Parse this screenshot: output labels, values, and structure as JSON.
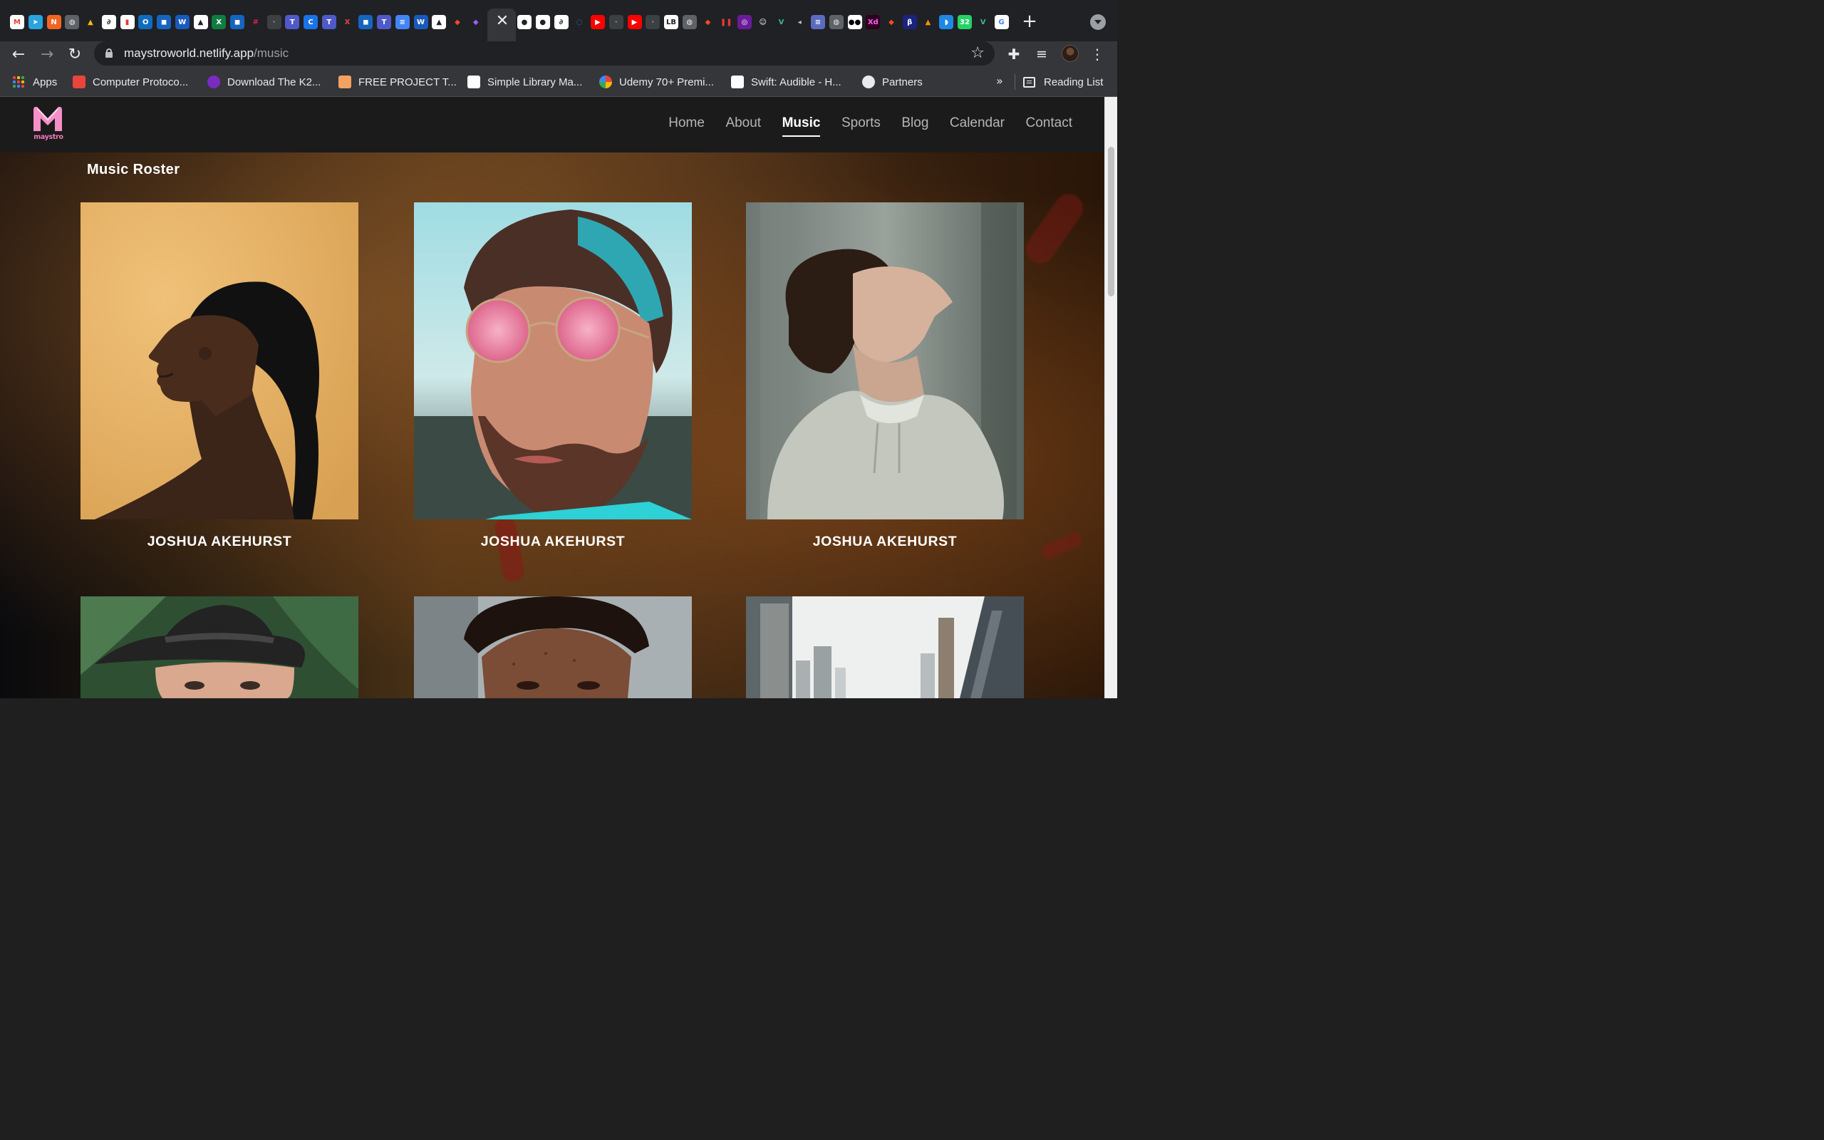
{
  "browser": {
    "tab_icons": [
      {
        "name": "gmail-icon",
        "color": "#ffffff",
        "fg": "#ea4335",
        "glyph": "M"
      },
      {
        "name": "telegram-icon",
        "color": "#2aa3df",
        "fg": "#ffffff",
        "glyph": "➤"
      },
      {
        "name": "tab-orange-icon",
        "color": "#f26522",
        "fg": "#ffffff",
        "glyph": "N"
      },
      {
        "name": "globe-icon",
        "color": "#5f6368",
        "fg": "#e8eaed",
        "glyph": "◍"
      },
      {
        "name": "google-drive-icon",
        "color": "#202124",
        "fg": "#fbbc04",
        "glyph": "▲"
      },
      {
        "name": "tab-yellow-icon",
        "color": "#ffffff",
        "fg": "#202124",
        "glyph": "∂"
      },
      {
        "name": "tab-red-white-icon",
        "color": "#ffffff",
        "fg": "#e53935",
        "glyph": "▮"
      },
      {
        "name": "outlook-icon",
        "color": "#0f6cbd",
        "fg": "#ffffff",
        "glyph": "O"
      },
      {
        "name": "tab-blue-shield-icon",
        "color": "#1565c0",
        "fg": "#ffffff",
        "glyph": "◼"
      },
      {
        "name": "word-icon",
        "color": "#185abd",
        "fg": "#ffffff",
        "glyph": "W"
      },
      {
        "name": "tab-triangle-icon",
        "color": "#ffffff",
        "fg": "#202124",
        "glyph": "▲"
      },
      {
        "name": "excel-icon",
        "color": "#107c41",
        "fg": "#ffffff",
        "glyph": "X"
      },
      {
        "name": "tab-blue-shield-icon",
        "color": "#1565c0",
        "fg": "#ffffff",
        "glyph": "◼"
      },
      {
        "name": "slack-icon",
        "color": "#202124",
        "fg": "#e01e5a",
        "glyph": "#"
      },
      {
        "name": "tab-dark-icon",
        "color": "#3c4043",
        "fg": "#9aa0a6",
        "glyph": "·"
      },
      {
        "name": "teams-icon",
        "color": "#5059c9",
        "fg": "#ffffff",
        "glyph": "T"
      },
      {
        "name": "tab-c-icon",
        "color": "#1a73e8",
        "fg": "#ffffff",
        "glyph": "C"
      },
      {
        "name": "teams-icon",
        "color": "#5059c9",
        "fg": "#ffffff",
        "glyph": "T"
      },
      {
        "name": "tab-x-icon",
        "color": "#202124",
        "fg": "#e8453c",
        "glyph": "X"
      },
      {
        "name": "tab-blue-shield-icon",
        "color": "#1565c0",
        "fg": "#ffffff",
        "glyph": "◼"
      },
      {
        "name": "teams-icon",
        "color": "#5059c9",
        "fg": "#ffffff",
        "glyph": "T"
      },
      {
        "name": "google-docs-icon",
        "color": "#4285f4",
        "fg": "#ffffff",
        "glyph": "≡"
      },
      {
        "name": "word-icon",
        "color": "#185abd",
        "fg": "#ffffff",
        "glyph": "W"
      },
      {
        "name": "tab-triangle-icon",
        "color": "#ffffff",
        "fg": "#202124",
        "glyph": "▲"
      },
      {
        "name": "figma-icon",
        "color": "#202124",
        "fg": "#f24e1e",
        "glyph": "◆"
      },
      {
        "name": "figma-icon",
        "color": "#202124",
        "fg": "#a259ff",
        "glyph": "◆"
      }
    ],
    "tab_icons_right": [
      {
        "name": "github-icon",
        "color": "#ffffff",
        "fg": "#202124",
        "glyph": "●"
      },
      {
        "name": "github-icon",
        "color": "#ffffff",
        "fg": "#202124",
        "glyph": "●"
      },
      {
        "name": "tab-yellow-icon",
        "color": "#ffffff",
        "fg": "#202124",
        "glyph": "∂"
      },
      {
        "name": "tab-blue-circle-icon",
        "color": "#202124",
        "fg": "#4285f4",
        "glyph": "◌"
      },
      {
        "name": "youtube-icon",
        "color": "#ff0000",
        "fg": "#ffffff",
        "glyph": "▶"
      },
      {
        "name": "tab-dark-icon",
        "color": "#3c4043",
        "fg": "#9aa0a6",
        "glyph": "·"
      },
      {
        "name": "youtube-icon",
        "color": "#ff0000",
        "fg": "#ffffff",
        "glyph": "▶"
      },
      {
        "name": "tab-dark-icon",
        "color": "#3c4043",
        "fg": "#9aa0a6",
        "glyph": "·"
      },
      {
        "name": "lb-icon",
        "color": "#ffffff",
        "fg": "#202124",
        "glyph": "LB"
      },
      {
        "name": "globe-icon",
        "color": "#5f6368",
        "fg": "#e8eaed",
        "glyph": "◍"
      },
      {
        "name": "figma-icon",
        "color": "#202124",
        "fg": "#f24e1e",
        "glyph": "◆"
      },
      {
        "name": "tab-pause-icon",
        "color": "#202124",
        "fg": "#e53935",
        "glyph": "❚❚"
      },
      {
        "name": "tab-purple-icon",
        "color": "#6a1b9a",
        "fg": "#ffffff",
        "glyph": "◎"
      },
      {
        "name": "tab-ghost-icon",
        "color": "#202124",
        "fg": "#ffffff",
        "glyph": "☺"
      },
      {
        "name": "vue-icon",
        "color": "#202124",
        "fg": "#41b883",
        "glyph": "V"
      },
      {
        "name": "speaker-icon",
        "color": "#202124",
        "fg": "#bdc1c6",
        "glyph": "◂"
      },
      {
        "name": "tab-list-icon",
        "color": "#5c6bc0",
        "fg": "#ffffff",
        "glyph": "≡"
      },
      {
        "name": "globe-icon",
        "color": "#5f6368",
        "fg": "#e8eaed",
        "glyph": "◍"
      },
      {
        "name": "medium-icon",
        "color": "#ffffff",
        "fg": "#000000",
        "glyph": "●●"
      },
      {
        "name": "adobe-xd-icon",
        "color": "#2e001f",
        "fg": "#ff61f6",
        "glyph": "Xd"
      },
      {
        "name": "figma-icon",
        "color": "#202124",
        "fg": "#f24e1e",
        "glyph": "◆"
      },
      {
        "name": "tab-bolt-icon",
        "color": "#1a237e",
        "fg": "#ffffff",
        "glyph": "β"
      },
      {
        "name": "tab-orange-triangle-icon",
        "color": "#202124",
        "fg": "#ff8f00",
        "glyph": "▲"
      },
      {
        "name": "tab-blue-leaf-icon",
        "color": "#1e88e5",
        "fg": "#ffffff",
        "glyph": "◗"
      },
      {
        "name": "whatsapp-icon",
        "color": "#25d366",
        "fg": "#ffffff",
        "glyph": "32"
      },
      {
        "name": "vue-icon",
        "color": "#202124",
        "fg": "#41b883",
        "glyph": "V"
      },
      {
        "name": "google-icon",
        "color": "#ffffff",
        "fg": "#4285f4",
        "glyph": "G"
      }
    ],
    "active_tab_close": "✕",
    "new_tab": "+",
    "url_host": "maystroworld.netlify.app",
    "url_path": "/music",
    "bookmarks": [
      {
        "label": "Apps",
        "icon": "apps-icon"
      },
      {
        "label": "Computer Protoco...",
        "icon": "bookmark-red-icon",
        "color": "#e8453c"
      },
      {
        "label": "Download The K2...",
        "icon": "bookmark-purple-icon",
        "color": "#7b2cbf"
      },
      {
        "label": "FREE PROJECT T...",
        "icon": "bookmark-orange-icon",
        "color": "#f4a261"
      },
      {
        "label": "Simple Library Ma...",
        "icon": "bookmark-k-icon",
        "color": "#ffffff"
      },
      {
        "label": "Udemy 70+ Premi...",
        "icon": "google-icon",
        "color": "#4285f4"
      },
      {
        "label": "Swift: Audible - H...",
        "icon": "lb-icon",
        "color": "#ffffff"
      },
      {
        "label": "Partners",
        "icon": "globe-icon",
        "color": "#e8eaed"
      }
    ],
    "bookmarks_overflow": "»",
    "reading_list": "Reading List"
  },
  "site": {
    "logo_text": "maystro",
    "logo_color": "#f48fc8",
    "nav": [
      {
        "label": "Home",
        "active": false
      },
      {
        "label": "About",
        "active": false
      },
      {
        "label": "Music",
        "active": true
      },
      {
        "label": "Sports",
        "active": false
      },
      {
        "label": "Blog",
        "active": false
      },
      {
        "label": "Calendar",
        "active": false
      },
      {
        "label": "Contact",
        "active": false
      }
    ],
    "section_title": "Music Roster",
    "artists": [
      {
        "name": "JOSHUA AKEHURST",
        "photo": "woman-profile-braid"
      },
      {
        "name": "JOSHUA AKEHURST",
        "photo": "man-pink-sunglasses"
      },
      {
        "name": "JOSHUA AKEHURST",
        "photo": "man-grey-hoodie"
      },
      {
        "name": "",
        "photo": "woman-black-hat"
      },
      {
        "name": "",
        "photo": "man-curly-hair-freckles"
      },
      {
        "name": "",
        "photo": "city-buildings"
      }
    ]
  }
}
